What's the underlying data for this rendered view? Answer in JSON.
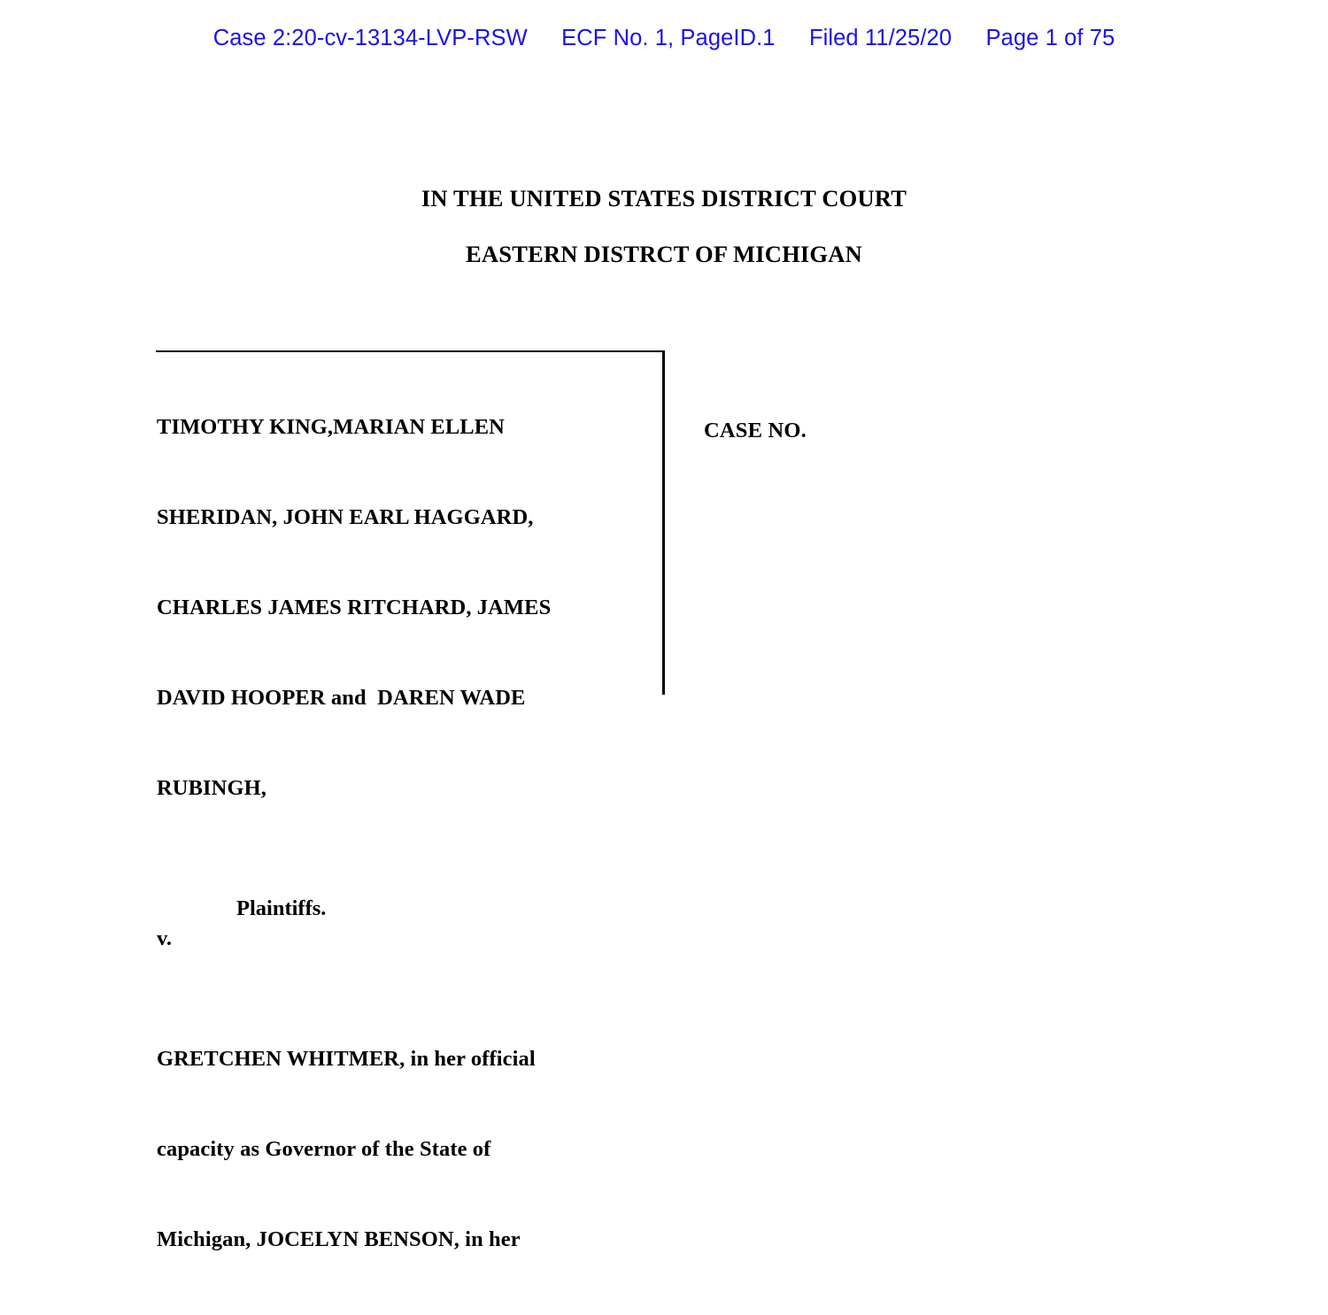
{
  "document": {
    "background_color": "#ffffff",
    "text_color": "#000000"
  },
  "ecf_header": {
    "color": "#1a13e8",
    "case_number": "Case 2:20-cv-13134-LVP-RSW",
    "ecf_entry": "ECF No. 1, PageID.1",
    "filed": "Filed 11/25/20",
    "page": "Page 1 of 75"
  },
  "court": {
    "line1": "IN THE UNITED STATES DISTRICT COURT",
    "line2": "EASTERN DISTRCT OF MICHIGAN"
  },
  "caption": {
    "plaintiffs": {
      "lines": [
        "TIMOTHY KING,MARIAN ELLEN",
        "SHERIDAN, JOHN EARL HAGGARD,",
        "CHARLES JAMES RITCHARD, JAMES",
        "DAVID HOOPER and  DAREN WADE",
        "RUBINGH,"
      ],
      "role_label": "Plaintiffs.",
      "versus_label": "v."
    },
    "defendants": {
      "lines": [
        "GRETCHEN WHITMER, in her official",
        "capacity as Governor of the State of",
        "Michigan, JOCELYN BENSON, in her"
      ]
    },
    "case_number_label": "CASE NO."
  }
}
